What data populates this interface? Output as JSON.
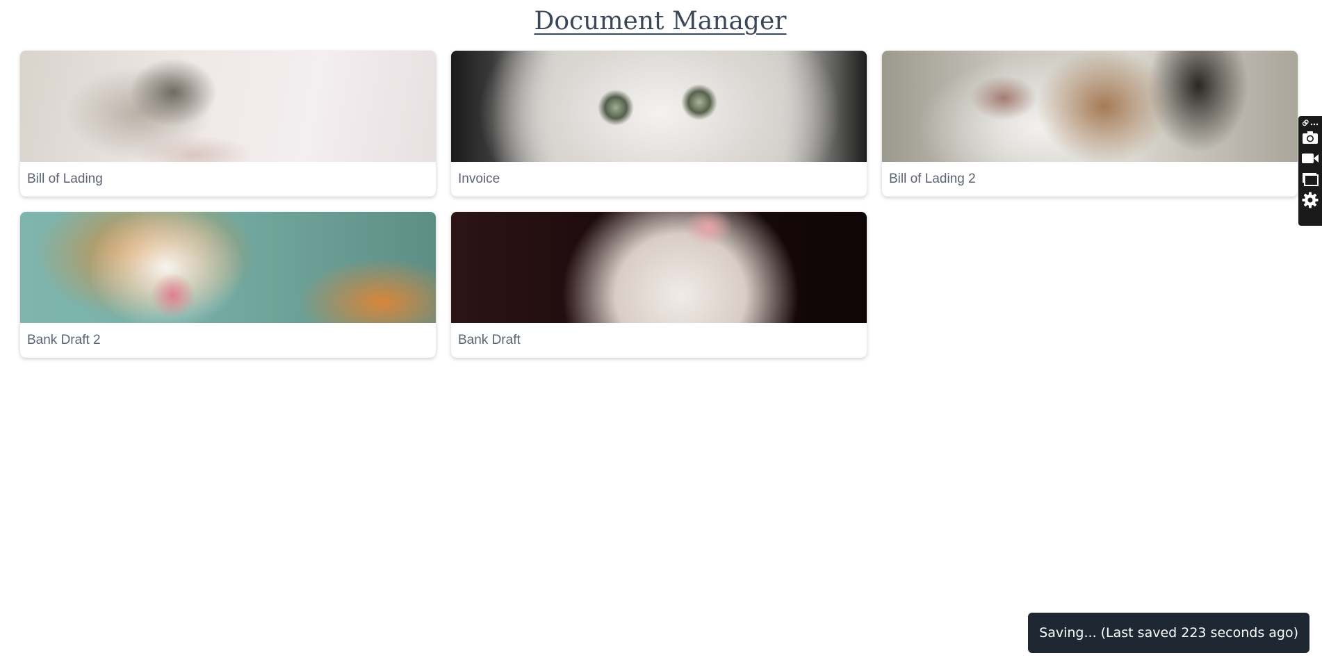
{
  "page": {
    "title": "Document Manager"
  },
  "documents": [
    {
      "label": "Bill of Lading"
    },
    {
      "label": "Invoice"
    },
    {
      "label": "Bill of Lading 2"
    },
    {
      "label": "Bank Draft 2"
    },
    {
      "label": "Bank Draft"
    }
  ],
  "toolbar": {
    "icons": [
      "link-icon",
      "more-icon",
      "camera-icon",
      "video-camera-icon",
      "window-icon",
      "gear-icon"
    ]
  },
  "status": {
    "message": "Saving... (Last saved 223 seconds ago)"
  }
}
